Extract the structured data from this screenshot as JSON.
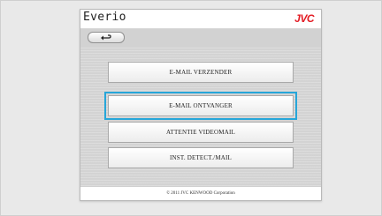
{
  "header": {
    "app_name": "Everio",
    "brand_logo": "JVC"
  },
  "toolbar": {
    "back_icon": "return-arrow-icon"
  },
  "menu": {
    "items": [
      {
        "label": "E-MAIL VERZENDER",
        "selected": false
      },
      {
        "label": "E-MAIL ONTVANGER",
        "selected": true
      },
      {
        "label": "ATTENTIE VIDEOMAIL",
        "selected": false
      },
      {
        "label": "INST. DETECT./MAIL",
        "selected": false
      }
    ]
  },
  "footer": {
    "copyright": "© 2011 JVC KENWOOD Corporation"
  },
  "colors": {
    "brand_red": "#e31b23",
    "selection": "#27a6d9"
  }
}
